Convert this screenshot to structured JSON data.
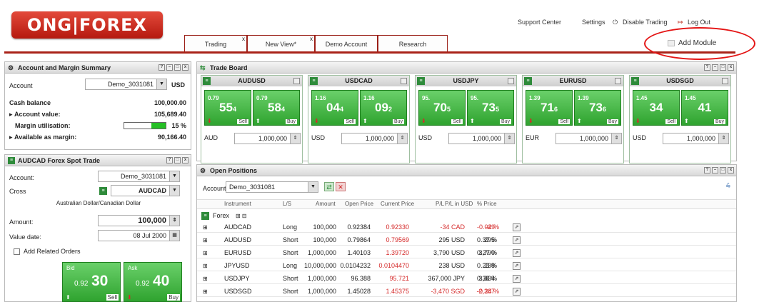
{
  "header": {
    "logo": "ONG|FOREX",
    "links": [
      "Support Center",
      "Settings",
      "Disable Trading",
      "Log Out"
    ],
    "tabs": [
      "Trading",
      "New View*",
      "Demo Account",
      "Research"
    ],
    "add_module": "Add Module"
  },
  "account_summary": {
    "title": "Account and Margin Summary",
    "account_label": "Account",
    "account_value": "Demo_3031081",
    "currency": "USD",
    "rows": [
      {
        "label": "Cash balance",
        "value": "100,000.00"
      },
      {
        "label": "Account value:",
        "value": "105,689.40"
      },
      {
        "label": "Margin utilisation:",
        "value": "15 %"
      },
      {
        "label": "Available as margin:",
        "value": "90,166.40"
      }
    ],
    "margin_fill": 0.15
  },
  "spot_trade": {
    "title": "AUDCAD  Forex Spot Trade",
    "account_label": "Account:",
    "account_value": "Demo_3031081",
    "cross_label": "Cross",
    "cross_value": "AUDCAD",
    "cross_desc": "Australian Dollar/Canadian Dollar",
    "amount_label": "Amount:",
    "amount_value": "100,000",
    "value_date_label": "Value date:",
    "value_date": "08 Jul 2000",
    "related_orders": "Add Related Orders",
    "bid_label": "Bid",
    "ask_label": "Ask",
    "bid_small": "0.92",
    "bid_big": "30",
    "ask_small": "0.92",
    "ask_big": "40",
    "sell": "Sell",
    "buy": "Buy"
  },
  "trade_board": {
    "title": "Trade Board",
    "cards": [
      {
        "pair": "AUDUSD",
        "sell_small": "0.79",
        "sell_big": "55",
        "sell_sub": "4",
        "buy_small": "0.79",
        "buy_big": "58",
        "buy_sub": "4",
        "ccy": "AUD",
        "amount": "1,000,000"
      },
      {
        "pair": "USDCAD",
        "sell_small": "1.16",
        "sell_big": "04",
        "sell_sub": "4",
        "buy_small": "1.16",
        "buy_big": "09",
        "buy_sub": "2",
        "ccy": "USD",
        "amount": "1,000,000"
      },
      {
        "pair": "USDJPY",
        "sell_small": "95.",
        "sell_big": "70",
        "sell_sub": "5",
        "buy_small": "95.",
        "buy_big": "73",
        "buy_sub": "5",
        "ccy": "USD",
        "amount": "1,000,000"
      },
      {
        "pair": "EURUSD",
        "sell_small": "1.39",
        "sell_big": "71",
        "sell_sub": "6",
        "buy_small": "1.39",
        "buy_big": "73",
        "buy_sub": "6",
        "ccy": "EUR",
        "amount": "1,000,000"
      },
      {
        "pair": "USDSGD",
        "sell_small": "1.45",
        "sell_big": "34",
        "sell_sub": "",
        "buy_small": "1.45",
        "buy_big": "41",
        "buy_sub": "",
        "ccy": "USD",
        "amount": "1,000,000"
      }
    ],
    "sell": "Sell",
    "buy": "Buy"
  },
  "open_positions": {
    "title": "Open Positions",
    "account_label": "Account",
    "account_value": "Demo_3031081",
    "columns": [
      "Instrument",
      "L/S",
      "Amount",
      "Open Price",
      "Current Price",
      "P/L",
      "P/L in USD",
      "% Price"
    ],
    "group": "Forex",
    "rows": [
      [
        "AUDCAD",
        "Long",
        "100,000",
        "0.92384",
        "0.92330",
        "-34 CAD",
        "-29",
        "-0.04 %"
      ],
      [
        "AUDUSD",
        "Short",
        "100,000",
        "0.79864",
        "0.79569",
        "295 USD",
        "295",
        "0.37 %"
      ],
      [
        "EURUSD",
        "Short",
        "1,000,000",
        "1.40103",
        "1.39720",
        "3,790 USD",
        "3,790",
        "0.27 %"
      ],
      [
        "JPYUSD",
        "Long",
        "10,000,000",
        "0.0104232",
        "0.0104470",
        "238 USD",
        "238",
        "0.23 %"
      ],
      [
        "USDJPY",
        "Short",
        "1,000,000",
        "96.388",
        "95.721",
        "367,000 JPY",
        "3,834",
        "0.38 %"
      ],
      [
        "USDSGD",
        "Short",
        "1,000,000",
        "1.45028",
        "1.45375",
        "-3,470 SGD",
        "-2,387",
        "-0.24 %"
      ]
    ]
  }
}
